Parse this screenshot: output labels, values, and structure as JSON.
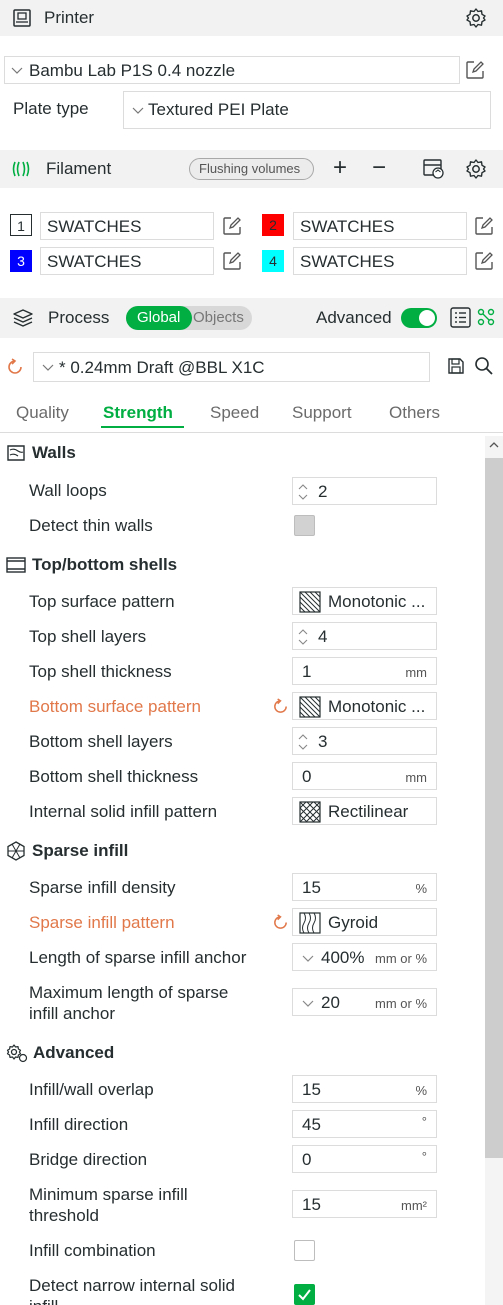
{
  "printer": {
    "title": "Printer",
    "name": "Bambu Lab P1S 0.4 nozzle",
    "plate_label": "Plate type",
    "plate_value": "Textured PEI Plate"
  },
  "filament": {
    "title": "Filament",
    "flushing_label": "Flushing volumes",
    "plus": "+",
    "minus": "−",
    "items": [
      {
        "num": "1",
        "name": "SWATCHES",
        "color": "#ffffff",
        "text_color": "#262e30"
      },
      {
        "num": "2",
        "name": "SWATCHES",
        "color": "#ff0000",
        "text_color": "#262e30"
      },
      {
        "num": "3",
        "name": "SWATCHES",
        "color": "#0000ff",
        "text_color": "#ffffff"
      },
      {
        "num": "4",
        "name": "SWATCHES",
        "color": "#00ffff",
        "text_color": "#262e30"
      }
    ]
  },
  "process": {
    "title": "Process",
    "global_label": "Global",
    "objects_label": "Objects",
    "advanced_label": "Advanced",
    "advanced_on": true,
    "preset": "* 0.24mm Draft @BBL X1C",
    "tabs": [
      "Quality",
      "Strength",
      "Speed",
      "Support",
      "Others"
    ],
    "active_tab": "Strength"
  },
  "sections": {
    "walls": "Walls",
    "topbottom": "Top/bottom shells",
    "sparse": "Sparse infill",
    "advanced": "Advanced"
  },
  "rows": {
    "wall_loops": {
      "label": "Wall loops",
      "value": "2"
    },
    "detect_thin": {
      "label": "Detect thin walls",
      "checked": false
    },
    "top_pattern": {
      "label": "Top surface pattern",
      "value": "Monotonic ..."
    },
    "top_layers": {
      "label": "Top shell layers",
      "value": "4"
    },
    "top_thick": {
      "label": "Top shell thickness",
      "value": "1",
      "unit": "mm"
    },
    "bottom_pattern": {
      "label": "Bottom surface pattern",
      "value": "Monotonic ..."
    },
    "bottom_layers": {
      "label": "Bottom shell layers",
      "value": "3"
    },
    "bottom_thick": {
      "label": "Bottom shell thickness",
      "value": "0",
      "unit": "mm"
    },
    "internal_pattern": {
      "label": "Internal solid infill pattern",
      "value": "Rectilinear"
    },
    "sparse_density": {
      "label": "Sparse infill density",
      "value": "15",
      "unit": "%"
    },
    "sparse_pattern": {
      "label": "Sparse infill pattern",
      "value": "Gyroid"
    },
    "anchor_len": {
      "label": "Length of sparse infill anchor",
      "value": "400%",
      "unit": "mm or %"
    },
    "anchor_max_1": {
      "label": "Maximum length of sparse",
      "value": "20",
      "unit": "mm or %"
    },
    "anchor_max_2": {
      "label": "infill anchor"
    },
    "overlap": {
      "label": "Infill/wall overlap",
      "value": "15",
      "unit": "%"
    },
    "direction": {
      "label": "Infill direction",
      "value": "45",
      "unit": "°"
    },
    "bridge": {
      "label": "Bridge direction",
      "value": "0",
      "unit": "°"
    },
    "min_sparse_1": {
      "label": "Minimum sparse infill",
      "value": "15",
      "unit": "mm²"
    },
    "min_sparse_2": {
      "label": "threshold"
    },
    "combination": {
      "label": "Infill combination",
      "checked": false
    },
    "narrow_1": {
      "label": "Detect narrow internal solid",
      "checked": true
    },
    "narrow_2": {
      "label": "infill"
    }
  },
  "colors": {
    "accent": "#00ae42",
    "modified": "#e1784a",
    "header_bg": "#f2f2f2"
  }
}
